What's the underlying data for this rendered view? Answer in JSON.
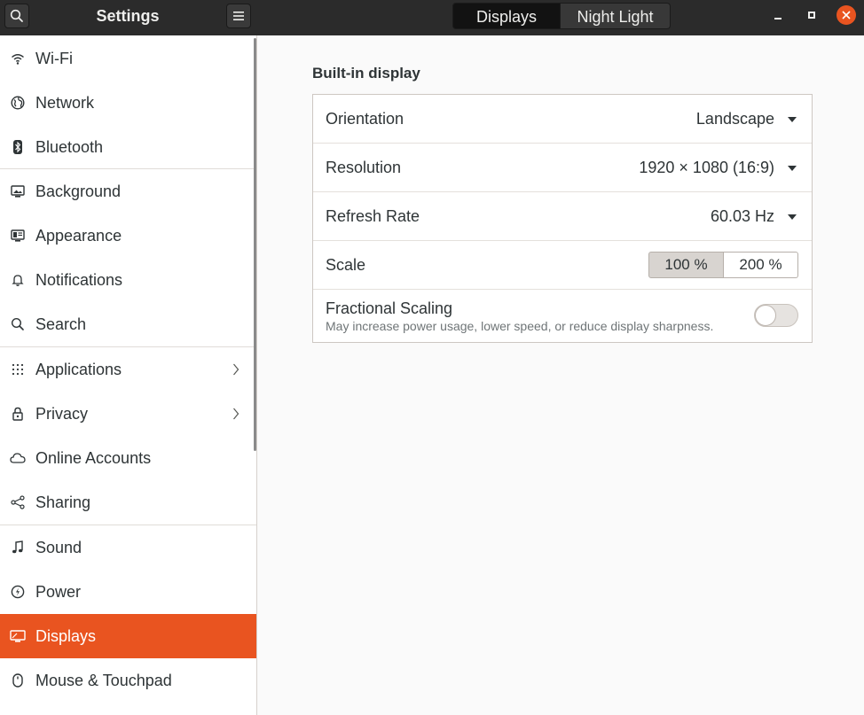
{
  "header": {
    "app_title": "Settings",
    "tabs": [
      {
        "label": "Displays",
        "active": true
      },
      {
        "label": "Night Light",
        "active": false
      }
    ]
  },
  "sidebar": {
    "items": [
      {
        "label": "Wi-Fi",
        "icon": "wifi-icon"
      },
      {
        "label": "Network",
        "icon": "globe-icon"
      },
      {
        "label": "Bluetooth",
        "icon": "bluetooth-icon"
      },
      {
        "label": "Background",
        "icon": "background-icon"
      },
      {
        "label": "Appearance",
        "icon": "appearance-icon"
      },
      {
        "label": "Notifications",
        "icon": "bell-icon"
      },
      {
        "label": "Search",
        "icon": "search-icon"
      },
      {
        "label": "Applications",
        "icon": "grid-icon",
        "has_submenu": true
      },
      {
        "label": "Privacy",
        "icon": "lock-icon",
        "has_submenu": true
      },
      {
        "label": "Online Accounts",
        "icon": "cloud-icon"
      },
      {
        "label": "Sharing",
        "icon": "share-icon"
      },
      {
        "label": "Sound",
        "icon": "music-note-icon"
      },
      {
        "label": "Power",
        "icon": "power-icon"
      },
      {
        "label": "Displays",
        "icon": "display-icon",
        "selected": true
      },
      {
        "label": "Mouse & Touchpad",
        "icon": "mouse-icon"
      }
    ]
  },
  "main": {
    "section_title": "Built-in display",
    "orientation": {
      "label": "Orientation",
      "value": "Landscape"
    },
    "resolution": {
      "label": "Resolution",
      "value": "1920 × 1080 (16:9)"
    },
    "refresh_rate": {
      "label": "Refresh Rate",
      "value": "60.03 Hz"
    },
    "scale": {
      "label": "Scale",
      "options": [
        "100 %",
        "200 %"
      ],
      "selected": "100 %"
    },
    "fractional_scaling": {
      "label": "Fractional Scaling",
      "description": "May increase power usage, lower speed, or reduce display sharpness.",
      "enabled": false
    }
  },
  "colors": {
    "accent": "#e95420",
    "headerbar": "#2b2b2b"
  }
}
